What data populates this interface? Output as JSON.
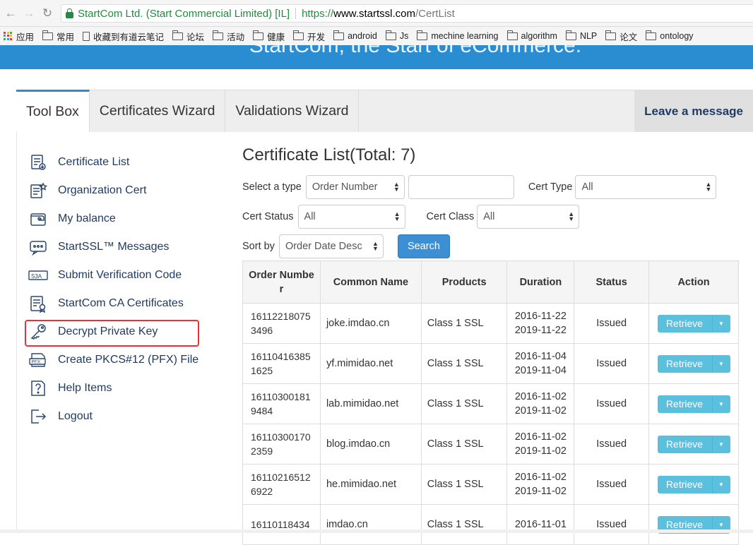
{
  "browser": {
    "back_icon": "arrow-left-icon",
    "forward_icon": "arrow-right-icon",
    "reload_icon": "reload-icon",
    "org": "StartCom Ltd. (Start Commercial Limited) [IL]",
    "url_scheme": "https://",
    "url_host": "www.startssl.com",
    "url_path": "/CertList"
  },
  "bookmarks": {
    "apps": "应用",
    "items": [
      "常用",
      "收藏到有道云笔记",
      "论坛",
      "活动",
      "健康",
      "开发",
      "android",
      "Js",
      "mechine learning",
      "algorithm",
      "NLP",
      "论文",
      "ontology"
    ]
  },
  "banner": {
    "text": "StartCom, the Start of eCommerce."
  },
  "tabs": {
    "toolbox": "Tool Box",
    "certificates": "Certificates Wizard",
    "validations": "Validations Wizard",
    "leave": "Leave a message"
  },
  "sidebar": {
    "items": [
      {
        "label": "Certificate List",
        "icon": "certificate-list-icon"
      },
      {
        "label": "Organization Cert",
        "icon": "organization-cert-icon"
      },
      {
        "label": "My balance",
        "icon": "wallet-icon"
      },
      {
        "label": "StartSSL™ Messages",
        "icon": "message-icon"
      },
      {
        "label": "Submit Verification Code",
        "icon": "verification-code-icon"
      },
      {
        "label": "StartCom CA Certificates",
        "icon": "ca-certificate-icon"
      },
      {
        "label": "Decrypt Private Key",
        "icon": "key-icon"
      },
      {
        "label": "Create PKCS#12 (PFX) File",
        "icon": "pfx-file-icon"
      },
      {
        "label": "Help Items",
        "icon": "help-icon"
      },
      {
        "label": "Logout",
        "icon": "logout-icon"
      }
    ]
  },
  "main": {
    "title": "Certificate List(Total: 7)",
    "filters": {
      "select_type_label": "Select a type",
      "select_type_value": "Order Number",
      "search_value": "",
      "cert_type_label": "Cert Type",
      "cert_type_value": "All",
      "cert_status_label": "Cert Status",
      "cert_status_value": "All",
      "cert_class_label": "Cert Class",
      "cert_class_value": "All",
      "sort_label": "Sort by",
      "sort_value": "Order Date Desc",
      "search_button": "Search"
    }
  },
  "table": {
    "headers": [
      "Order Number",
      "Common Name",
      "Products",
      "Duration",
      "Status",
      "Action"
    ],
    "rows": [
      {
        "order1": "16112218075",
        "order2": "3496",
        "name": "joke.imdao.cn",
        "product": "Class 1 SSL",
        "start": "2016-11-22",
        "end": "2019-11-22",
        "status": "Issued",
        "action": "Retrieve"
      },
      {
        "order1": "16110416385",
        "order2": "1625",
        "name": "yf.mimidao.net",
        "product": "Class 1 SSL",
        "start": "2016-11-04",
        "end": "2019-11-04",
        "status": "Issued",
        "action": "Retrieve"
      },
      {
        "order1": "16110300181",
        "order2": "9484",
        "name": "lab.mimidao.net",
        "product": "Class 1 SSL",
        "start": "2016-11-02",
        "end": "2019-11-02",
        "status": "Issued",
        "action": "Retrieve"
      },
      {
        "order1": "16110300170",
        "order2": "2359",
        "name": "blog.imdao.cn",
        "product": "Class 1 SSL",
        "start": "2016-11-02",
        "end": "2019-11-02",
        "status": "Issued",
        "action": "Retrieve"
      },
      {
        "order1": "16110216512",
        "order2": "6922",
        "name": "he.mimidao.net",
        "product": "Class 1 SSL",
        "start": "2016-11-02",
        "end": "2019-11-02",
        "status": "Issued",
        "action": "Retrieve"
      },
      {
        "order1": "16110118434",
        "order2": "",
        "name": "imdao.cn",
        "product": "Class 1 SSL",
        "start": "2016-11-01",
        "end": "",
        "status": "Issued",
        "action": "Retrieve"
      }
    ]
  },
  "colors": {
    "accent": "#2a8cd1",
    "link": "#1f3b63",
    "retrieve": "#5bc0de",
    "highlight": "#e2343d"
  }
}
